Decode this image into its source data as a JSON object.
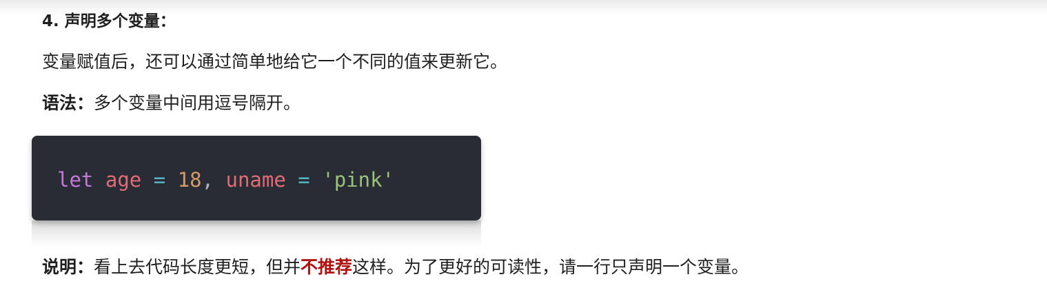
{
  "heading": "4. 声明多个变量：",
  "para1": "变量赋值后，还可以通过简单地给它一个不同的值来更新它。",
  "syntax": {
    "label": "语法：",
    "text": "多个变量中间用逗号隔开。"
  },
  "code": {
    "keyword": "let",
    "var1": "age",
    "eq1": "=",
    "num": "18",
    "comma": ",",
    "var2": "uname",
    "eq2": "=",
    "str": "'pink'"
  },
  "note": {
    "label": "说明：",
    "text_before": "看上去代码长度更短，但并",
    "emphasis": "不推荐",
    "text_after": "这样。为了更好的可读性，请一行只声明一个变量。"
  },
  "colors": {
    "emphasis": "#b01111",
    "code_background": "#2a2c35",
    "keyword": "#c678dd",
    "variable": "#e06c75",
    "operator": "#56b6c2",
    "number": "#d19a66",
    "string": "#98c379"
  }
}
